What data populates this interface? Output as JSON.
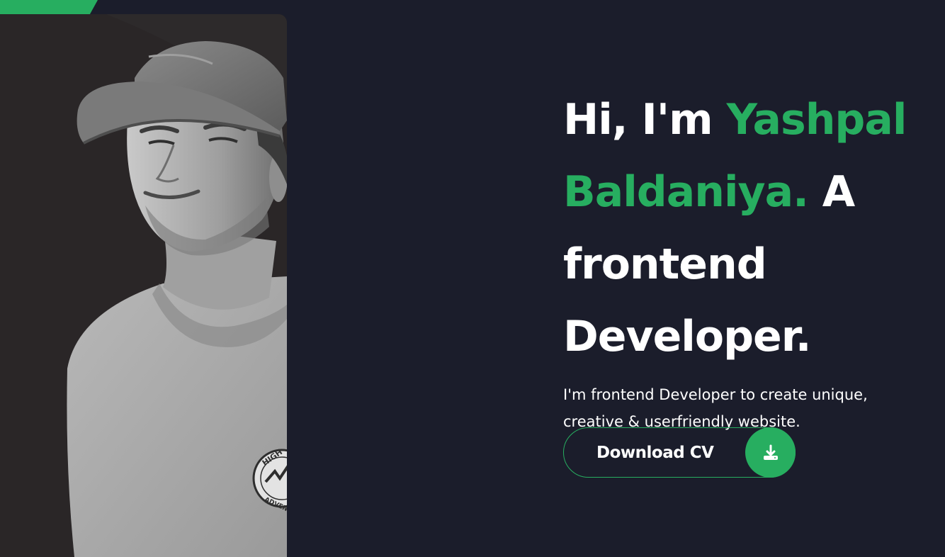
{
  "hero": {
    "greeting": "Hi, I'm ",
    "name_first": "Yashpal",
    "name_last": "Baldaniya.",
    "role_article": " A",
    "role_line1": "frontend",
    "role_line2": "Developer.",
    "description": "I'm frontend Developer to create unique, creative & userfriendly website."
  },
  "cta": {
    "label": "Download CV",
    "icon": "download-icon"
  },
  "photo": {
    "icon": "portrait-photo",
    "badge_text_top": "HIGH",
    "badge_text_bottom": "ADVENT"
  },
  "colors": {
    "background": "#1b1d2b",
    "accent": "#27ae60",
    "text": "#ffffff",
    "photo_bg": "#2a2627"
  }
}
